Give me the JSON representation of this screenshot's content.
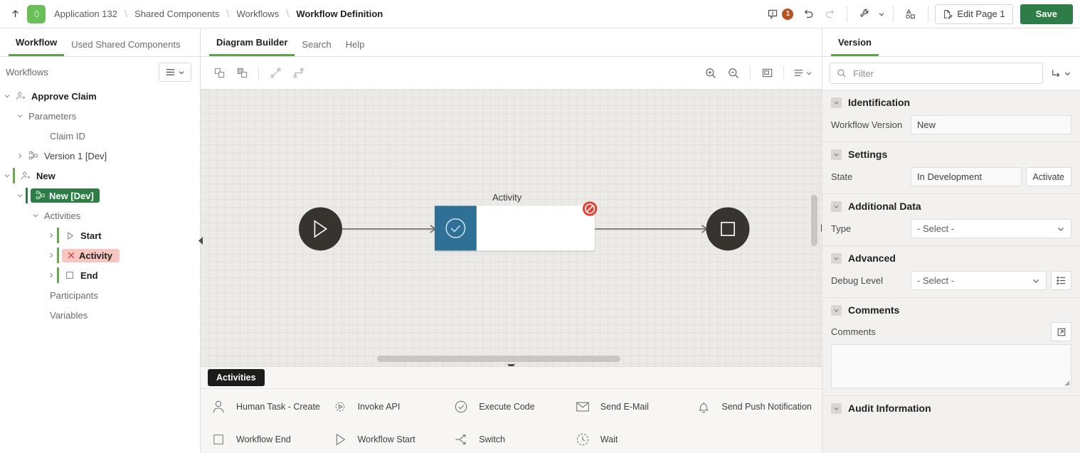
{
  "topbar": {
    "up_icon": "arrow-up-icon",
    "app_logo_icon": "application-logo-icon",
    "breadcrumb": [
      {
        "label": "Application 132",
        "current": false
      },
      {
        "label": "Shared Components",
        "current": false
      },
      {
        "label": "Workflows",
        "current": false
      },
      {
        "label": "Workflow Definition",
        "current": true
      }
    ],
    "separator": "\\",
    "messages_icon": "message-alert-icon",
    "messages_count": "1",
    "undo_icon": "undo-icon",
    "redo_icon": "redo-icon",
    "utilities_icon": "wrench-icon",
    "utilities_caret": "chevron-down-icon",
    "components_icon": "shapes-icon",
    "edit_page_icon": "page-edit-icon",
    "edit_page_label": "Edit Page 1",
    "save_label": "Save",
    "save_color": "#2e7d46",
    "badge_color": "#b5521f"
  },
  "left": {
    "tabs": [
      {
        "label": "Workflow",
        "active": true
      },
      {
        "label": "Used Shared Components",
        "active": false
      }
    ],
    "header_title": "Workflows",
    "menu_icon": "list-menu-icon",
    "menu_caret": "chevron-down-icon",
    "tree": [
      {
        "indent": 0,
        "twisty": "chevron-down",
        "icon": "workflow-icon",
        "label": "Approve Claim",
        "style": "bold",
        "bar": false
      },
      {
        "indent": 1,
        "twisty": "chevron-down",
        "icon": "none",
        "label": "Parameters",
        "style": "muted",
        "bar": false
      },
      {
        "indent": 2,
        "twisty": "none",
        "icon": "none",
        "label": "Claim ID",
        "style": "muted",
        "bar": false
      },
      {
        "indent": 1,
        "twisty": "chevron-right",
        "icon": "version-icon",
        "label": "Version 1 [Dev]",
        "style": "normal",
        "bar": false
      },
      {
        "indent": 0,
        "twisty": "chevron-down",
        "icon": "workflow-icon",
        "label": "New",
        "style": "bold",
        "bar": true
      },
      {
        "indent": 1,
        "twisty": "chevron-down",
        "icon": "version-icon",
        "label": "New [Dev]",
        "style": "selected",
        "bar": true
      },
      {
        "indent": 2,
        "twisty": "chevron-down",
        "icon": "none",
        "label": "Activities",
        "style": "muted",
        "bar": false
      },
      {
        "indent": 3,
        "twisty": "chevron-right",
        "icon": "start-icon",
        "label": "Start",
        "style": "bold",
        "bar": true
      },
      {
        "indent": 3,
        "twisty": "chevron-right",
        "icon": "error-x-icon",
        "label": "Activity",
        "style": "error",
        "bar": true
      },
      {
        "indent": 3,
        "twisty": "chevron-right",
        "icon": "end-icon",
        "label": "End",
        "style": "bold",
        "bar": true
      },
      {
        "indent": 2,
        "twisty": "none",
        "icon": "none",
        "label": "Participants",
        "style": "muted",
        "bar": false
      },
      {
        "indent": 2,
        "twisty": "none",
        "icon": "none",
        "label": "Variables",
        "style": "muted",
        "bar": false
      }
    ],
    "collapse_icon": "collapse-left-icon"
  },
  "center": {
    "tabs": [
      {
        "label": "Diagram Builder",
        "active": true
      },
      {
        "label": "Search",
        "active": false
      },
      {
        "label": "Help",
        "active": false
      }
    ],
    "toolbar": {
      "left_icons": [
        "bring-to-front-icon",
        "send-to-back-icon",
        "straight-connector-icon",
        "elbow-connector-icon"
      ],
      "right_icons": [
        "zoom-in-icon",
        "zoom-out-icon",
        "fit-to-screen-icon",
        "diagram-menu-icon"
      ],
      "right_menu_caret": "chevron-down-icon"
    },
    "diagram": {
      "nodes": [
        {
          "id": "start",
          "type": "start",
          "icon": "play-icon",
          "label": "",
          "shape": "circle",
          "color": "#37332f"
        },
        {
          "id": "activity",
          "type": "activity",
          "icon": "check-circle-icon",
          "label": "Activity",
          "shape": "card",
          "color": "#2e7096",
          "has_error": true,
          "error_icon": "error-no-entry-icon",
          "error_color": "#e0402f"
        },
        {
          "id": "end",
          "type": "end",
          "icon": "stop-square-icon",
          "label": "",
          "shape": "circle",
          "color": "#37332f"
        }
      ],
      "connectors": [
        {
          "from": "start",
          "to": "activity"
        },
        {
          "from": "activity",
          "to": "end"
        }
      ]
    },
    "hscroll_name": "horizontal-scrollbar",
    "vscroll_name": "vertical-scrollbar",
    "collapse_bottom_icon": "collapse-down-icon",
    "collapse_right_icon": "collapse-right-icon",
    "palette": {
      "tab_label": "Activities",
      "items": [
        {
          "icon": "person-icon",
          "label": "Human Task - Create"
        },
        {
          "icon": "gear-play-icon",
          "label": "Invoke API"
        },
        {
          "icon": "check-circle-icon",
          "label": "Execute Code"
        },
        {
          "icon": "envelope-icon",
          "label": "Send E-Mail"
        },
        {
          "icon": "bell-icon",
          "label": "Send Push Notification"
        },
        {
          "icon": "square-icon",
          "label": "Workflow End"
        },
        {
          "icon": "play-triangle-icon",
          "label": "Workflow Start"
        },
        {
          "icon": "switch-branch-icon",
          "label": "Switch"
        },
        {
          "icon": "clock-icon",
          "label": "Wait"
        }
      ]
    }
  },
  "right": {
    "tabs": [
      {
        "label": "Version",
        "active": true
      }
    ],
    "filter": {
      "icon": "search-icon",
      "placeholder": "Filter",
      "value": "",
      "goto_icon": "goto-icon",
      "goto_caret": "chevron-down-icon"
    },
    "sections": [
      {
        "title": "Identification",
        "toggle_icon": "chevron-down-icon",
        "fields": [
          {
            "kind": "text",
            "label": "Workflow Version",
            "value": "New"
          }
        ]
      },
      {
        "title": "Settings",
        "toggle_icon": "chevron-down-icon",
        "fields": [
          {
            "kind": "text-with-button",
            "label": "State",
            "value": "In Development",
            "button": "Activate"
          }
        ]
      },
      {
        "title": "Additional Data",
        "toggle_icon": "chevron-down-icon",
        "fields": [
          {
            "kind": "select",
            "label": "Type",
            "value": "- Select -",
            "caret": "chevron-down-icon"
          }
        ]
      },
      {
        "title": "Advanced",
        "toggle_icon": "chevron-down-icon",
        "fields": [
          {
            "kind": "select-with-icon",
            "label": "Debug Level",
            "value": "- Select -",
            "caret": "chevron-down-icon",
            "icon_button": "list-values-icon"
          }
        ]
      },
      {
        "title": "Comments",
        "toggle_icon": "chevron-down-icon",
        "fields": [
          {
            "kind": "textarea",
            "label": "Comments",
            "value": "",
            "expand_icon": "expand-editor-icon"
          }
        ]
      },
      {
        "title": "Audit Information",
        "toggle_icon": "chevron-down-icon",
        "fields": []
      }
    ]
  }
}
